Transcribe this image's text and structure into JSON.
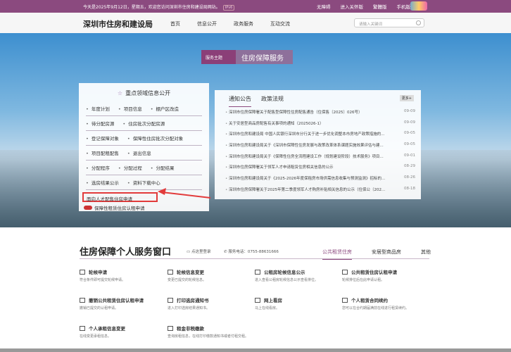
{
  "topbar": {
    "welcome": "今天是2025年9月12日，星期五，欢迎您访问深圳市住房和建设局网站。",
    "ipv6": "IPv6",
    "links": [
      "无障碍",
      "进入关怀版",
      "繁體版",
      "手机版"
    ]
  },
  "header": {
    "site": "深圳市住房和建设局",
    "nav": [
      "首页",
      "信息公开",
      "政务服务",
      "互动交流"
    ],
    "search_placeholder": "请输入关键词"
  },
  "badge": {
    "label": "服务主题",
    "title": "住房保障服务"
  },
  "left_panel": {
    "title": "重点领域信息公开",
    "rows": [
      [
        "年度计划",
        "项目信息",
        "棚户区改造"
      ],
      [
        "待分配房源",
        "住房批次分配房源"
      ],
      [
        "登记保障对象",
        "保障性住房批次分配对象"
      ],
      [
        "项目配租配售",
        "退出信息"
      ],
      [
        "分配程序",
        "分配过程",
        "分配结果"
      ],
      [
        "选房结果公示",
        "资料下载中心"
      ]
    ],
    "highlight": "面向人才配售住房申请",
    "rent_link": "保障性租赁住房认租申请"
  },
  "news": {
    "tabs": [
      "通知公告",
      "政策法规"
    ],
    "more": "更多+",
    "items": [
      {
        "title": "深圳市住房保障署关于配售型保障性住房配售通告（住保售〔2025〕026号）",
        "date": "09-09"
      },
      {
        "title": "关于安居型商品房配售有关事项的通知（2025026-1）",
        "date": "09-09"
      },
      {
        "title": "深圳市住房和建设局 中国人民银行深圳市分行关于进一步优化调整本市房地产政策措施的...",
        "date": "09-05"
      },
      {
        "title": "深圳市住房和建设局关于《深圳市保障性住房发展与政策改革体系课题实施效果评估与建...",
        "date": "09-05"
      },
      {
        "title": "深圳市住房和建设局关于《保障性住房全流程建设工作（规划建设阶段）技术服务》项目...",
        "date": "09-01"
      },
      {
        "title": "深圳市住房保障署关于领军人才申请租赁住房相关信息的公示",
        "date": "08-29"
      },
      {
        "title": "深圳市住房和建设局关于《2025-2026年度保租房市场供需信息收集与预测监测》招标的...",
        "date": "08-26"
      },
      {
        "title": "深圳市住房保障署关于2025年第二季度领军人才购房补贴相关信息的公示（住保公〔202...",
        "date": "08-18"
      }
    ]
  },
  "services": {
    "title": "住房保障个人服务窗口",
    "login": "点这里登录",
    "phone": "服务电话：0755-88631666",
    "tabs": [
      "公共租赁住房",
      "安居型商品房",
      "其他"
    ],
    "items": [
      {
        "name": "轮候申请",
        "desc": "符合条件即可提交轮候申请。"
      },
      {
        "name": "轮候信息变更",
        "desc": "变更已提交的轮候信息。"
      },
      {
        "name": "公租房轮候信息公示",
        "desc": "进入查看公租房轮候信息公示查看排位。"
      },
      {
        "name": "公共租赁住房认租申请",
        "desc": "轮候排位后在此申请认租。"
      },
      {
        "name": "撤销公共租赁住房认租申请",
        "desc": "撤销已提交的认租申请。"
      },
      {
        "name": "打印选房通知书",
        "desc": "进入打印选房结果通知书。"
      },
      {
        "name": "网上看房",
        "desc": "马上在线看房。"
      },
      {
        "name": "个人租赁合同续约",
        "desc": "您可以在合约期届满前在线进行租赁续约。"
      },
      {
        "name": "个人承租信息变更",
        "desc": "在线变更承租信息。"
      },
      {
        "name": "租金非税缴款",
        "desc": "查询房租信息，在线打印缴款通知书或者付租交租。"
      }
    ]
  }
}
